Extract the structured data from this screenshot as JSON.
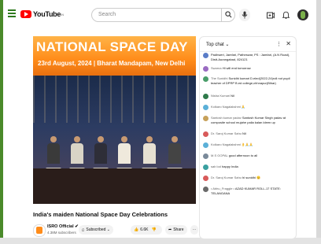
{
  "header": {
    "logo_text": "YouTube",
    "logo_region": "IN",
    "search_placeholder": "Search"
  },
  "video": {
    "banner_title": "National Space Day",
    "banner_subtitle": "23rd August, 2024 | Bharat Mandapam, New Delhi",
    "title": "India's maiden National Space Day Celebrations"
  },
  "channel": {
    "name": "ISRO Official ✔",
    "subscribers": "4.38M subscribers",
    "subscribed_label": "Subscribed ⌄",
    "likes": "6.6K",
    "share_label": "Share",
    "more_label": "⋯"
  },
  "chat": {
    "title": "Top chat ⌄",
    "menu": "⋮",
    "close": "✕",
    "messages": [
      {
        "author": "",
        "text": "Padhweri, Jamfari, Patheswar, PS : Jamfari, (A.N Road), Distt-Aurangabad, 824121",
        "color": "#5a7cc7"
      },
      {
        "author": "Swarna",
        "text": "Hi will end tomorrow",
        "color": "#9a6bc2"
      },
      {
        "author": "The Sunidhi",
        "text": "Sunidhi kumari D.eled(2022-24)roll not pupil teacher of DPRP B.ed college,chhnapur(Bihar)",
        "color": "#4a9e6a"
      },
      {
        "author": "Nisha Kumari",
        "text": "Nil",
        "color": "#2f7a4a"
      },
      {
        "author": "Kolkaro Nagalakshmi",
        "text": "🙏",
        "color": "#5bb0d8"
      },
      {
        "author": "Santosh kumar yadav",
        "text": "Santosh Kumar Singh yadav at composite school mujahe palia kalan ldeen up",
        "color": "#c7a15a"
      },
      {
        "author": "Dr. Saroj Kumar Sahu",
        "text": "Nil",
        "color": "#d85a5a"
      },
      {
        "author": "Kolkaro Nagalakshmi",
        "text": "👌🙏🙏",
        "color": "#5bb0d8"
      },
      {
        "author": "M.S GOPAL",
        "text": "good afternoon to all",
        "color": "#7a8a9a"
      },
      {
        "author": "sab lod",
        "text": "happy India",
        "color": "#3aa0a0"
      },
      {
        "author": "Dr. Saroj Kumar Sahu",
        "text": "hi sunidhi 😊",
        "color": "#d85a5a"
      },
      {
        "author": "• Abhu_Fraggle •",
        "text": "AZAD KUMAR ROLL-17 STATE: TELANGANA",
        "color": "#6a6a6a"
      }
    ]
  }
}
